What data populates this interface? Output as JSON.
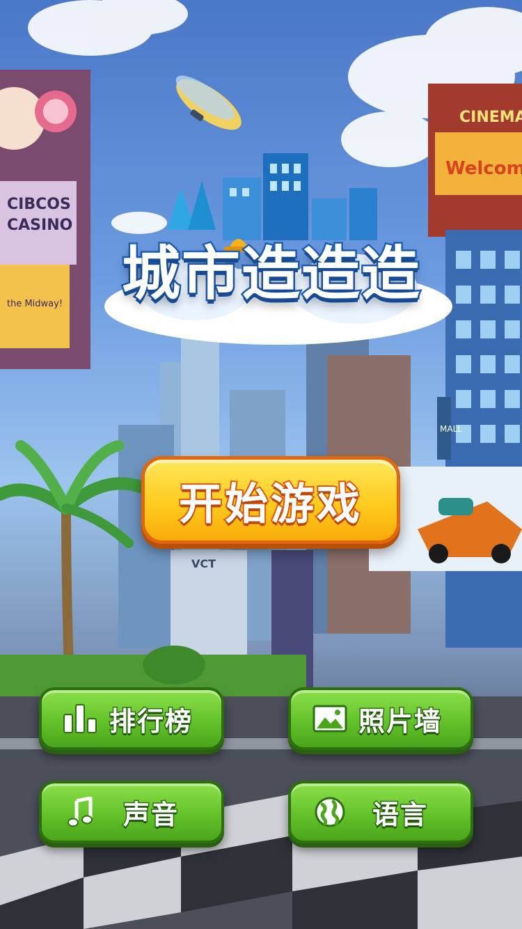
{
  "logo": {
    "title": "城市造造造"
  },
  "start_button": {
    "label": "开始游戏"
  },
  "menu": {
    "leaderboard": {
      "label": "排行榜",
      "icon": "bar-chart-icon"
    },
    "photo_wall": {
      "label": "照片墙",
      "icon": "picture-icon"
    },
    "sound": {
      "label": "声音",
      "icon": "music-note-icon"
    },
    "language": {
      "label": "语言",
      "icon": "globe-icon"
    }
  },
  "scenery": {
    "casino_sign": "CIBCOS CASINO",
    "casino_tagline": "the Midway!",
    "cinema_sign": "CINEMA",
    "cinema_welcome": "Welcome",
    "building_sign": "VCT",
    "mall_sign": "MALL"
  },
  "colors": {
    "start_button_fill": "#ffcb1f",
    "start_button_border": "#e2670c",
    "menu_button_fill": "#63c22a",
    "menu_button_border": "#2b6f0e",
    "logo_stroke": "#1e5fb8"
  }
}
